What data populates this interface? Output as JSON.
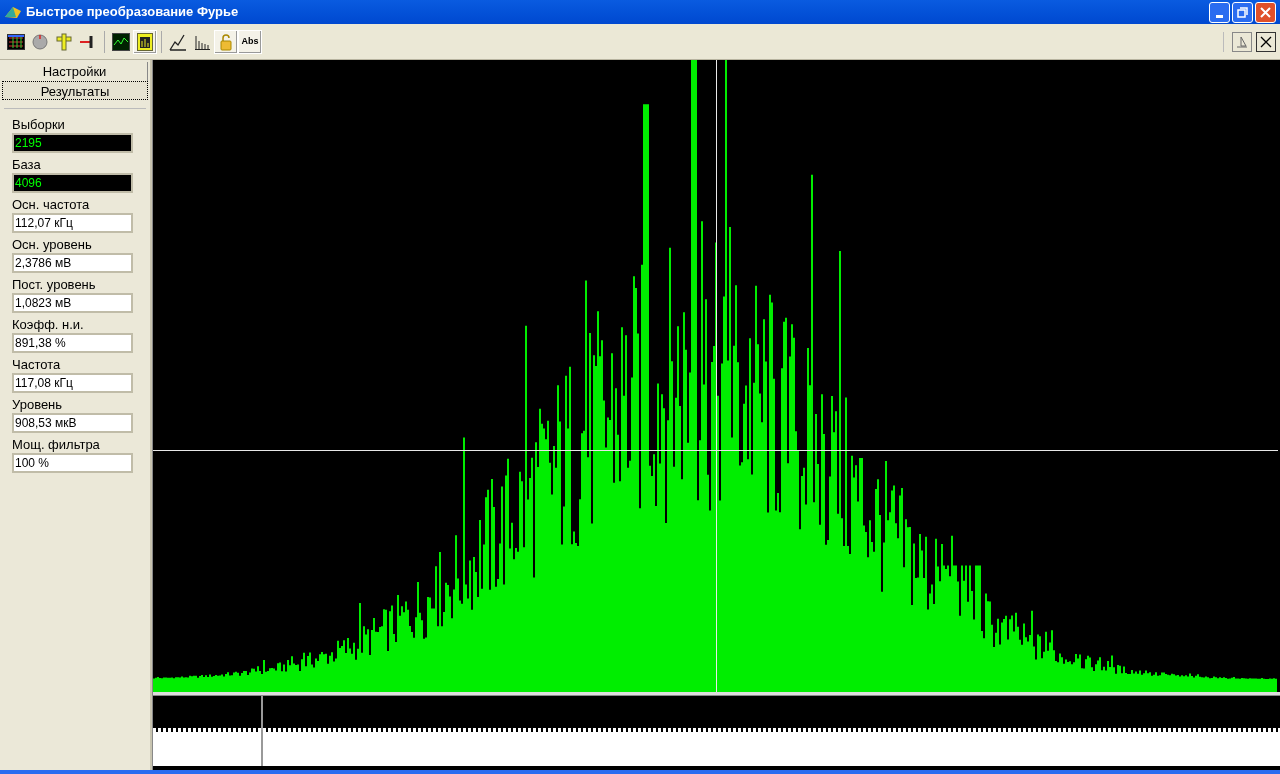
{
  "window": {
    "title": "Быстрое преобразование Фурье"
  },
  "toolbar": [
    {
      "pressed": false
    },
    {
      "pressed": false
    },
    {
      "pressed": false
    },
    {
      "pressed": false
    },
    {
      "pressed": false
    },
    {
      "pressed": true
    },
    {
      "pressed": false
    },
    {
      "pressed": false
    },
    {
      "pressed": true
    },
    {
      "label": "Abs",
      "pressed": true
    }
  ],
  "tabs": [
    {
      "label": "Настройки",
      "selected": false
    },
    {
      "label": "Результаты",
      "selected": true
    }
  ],
  "fields": [
    {
      "label": "Выборки",
      "value": "2195",
      "kind": "display"
    },
    {
      "label": "База",
      "value": "4096",
      "kind": "display"
    },
    {
      "label": "Осн. частота",
      "value": "112,07 кГц",
      "kind": "edit"
    },
    {
      "label": "Осн. уровень",
      "value": "2,3786 мВ",
      "kind": "edit"
    },
    {
      "label": "Пост. уровень",
      "value": "1,0823 мВ",
      "kind": "edit"
    },
    {
      "label": "Коэфф. н.и.",
      "value": "891,38 %",
      "kind": "edit"
    },
    {
      "label": "Частота",
      "value": "117,08 кГц",
      "kind": "edit"
    },
    {
      "label": "Уровень",
      "value": "908,53 мкВ",
      "kind": "edit"
    },
    {
      "label": "Мощ. фильтра",
      "value": "100 %",
      "kind": "edit"
    }
  ]
}
